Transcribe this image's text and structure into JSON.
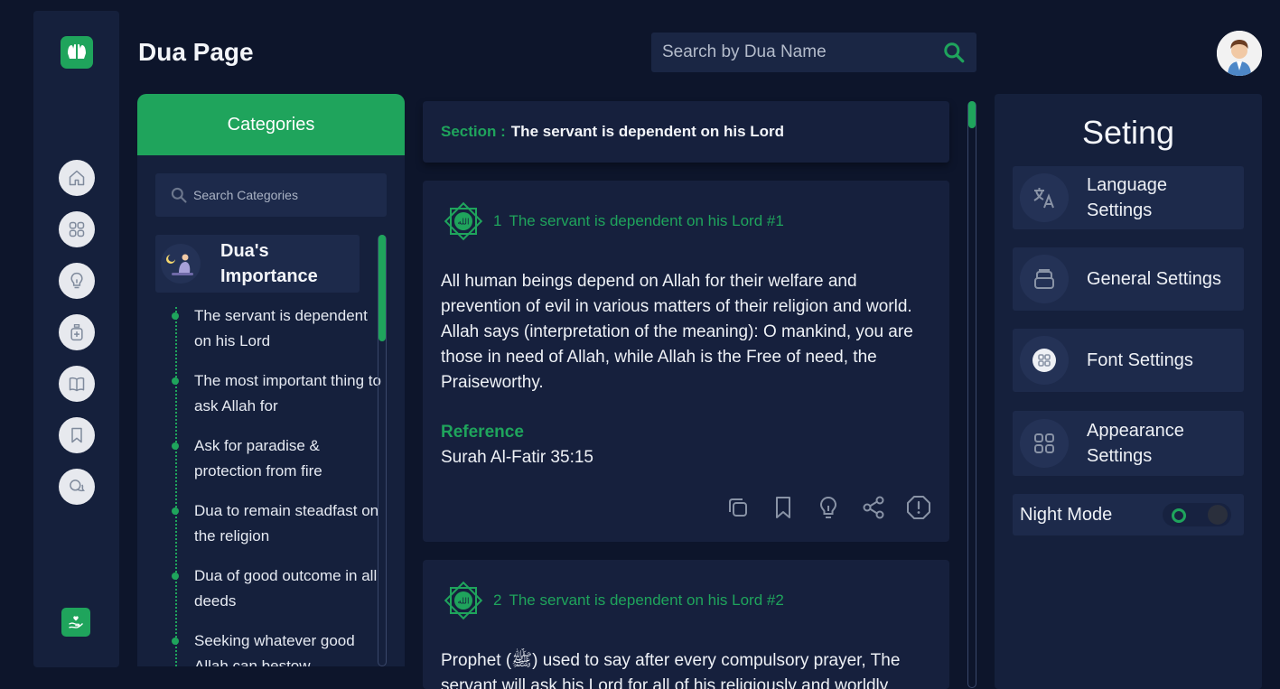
{
  "header": {
    "title": "Dua Page",
    "search_placeholder": "Search by Dua Name"
  },
  "rail": {
    "items": [
      "home-icon",
      "grid-icon",
      "bulb-icon",
      "bottle-icon",
      "book-icon",
      "bookmark-icon",
      "chat-icon"
    ]
  },
  "categories": {
    "heading": "Categories",
    "search_placeholder": "Search Categories",
    "active": {
      "title": "Dua's Importance"
    },
    "subitems": [
      "The servant is dependent on his Lord",
      "The most important thing to ask Allah for",
      "Ask for paradise & protection from fire",
      "Dua to remain steadfast on the religion",
      "Dua of good outcome in all deeds",
      "Seeking whatever good Allah can bestow"
    ]
  },
  "section": {
    "label": "Section :",
    "value": "The servant is dependent on his Lord"
  },
  "duas": [
    {
      "number": "1",
      "title": "The servant is dependent on his Lord #1",
      "text": "All human beings depend on Allah for their welfare and prevention of evil in various matters of their religion and world. Allah says (interpretation of the meaning): O mankind, you are those in need of Allah, while Allah is the Free of need, the Praiseworthy.",
      "reference_label": "Reference",
      "reference": "Surah Al-Fatir 35:15"
    },
    {
      "number": "2",
      "title": "The servant is dependent on his Lord #2",
      "text": "Prophet (ﷺ) used to say after every compulsory prayer, The servant will ask his Lord for all of his religiously and worldly"
    }
  ],
  "settings": {
    "title": "Seting",
    "items": [
      "Language Settings",
      "General Settings",
      "Font Settings",
      "Appearance Settings"
    ],
    "night_mode": "Night Mode"
  },
  "colors": {
    "accent": "#1fa45c",
    "background": "#0d152b",
    "panel": "#15203c"
  }
}
